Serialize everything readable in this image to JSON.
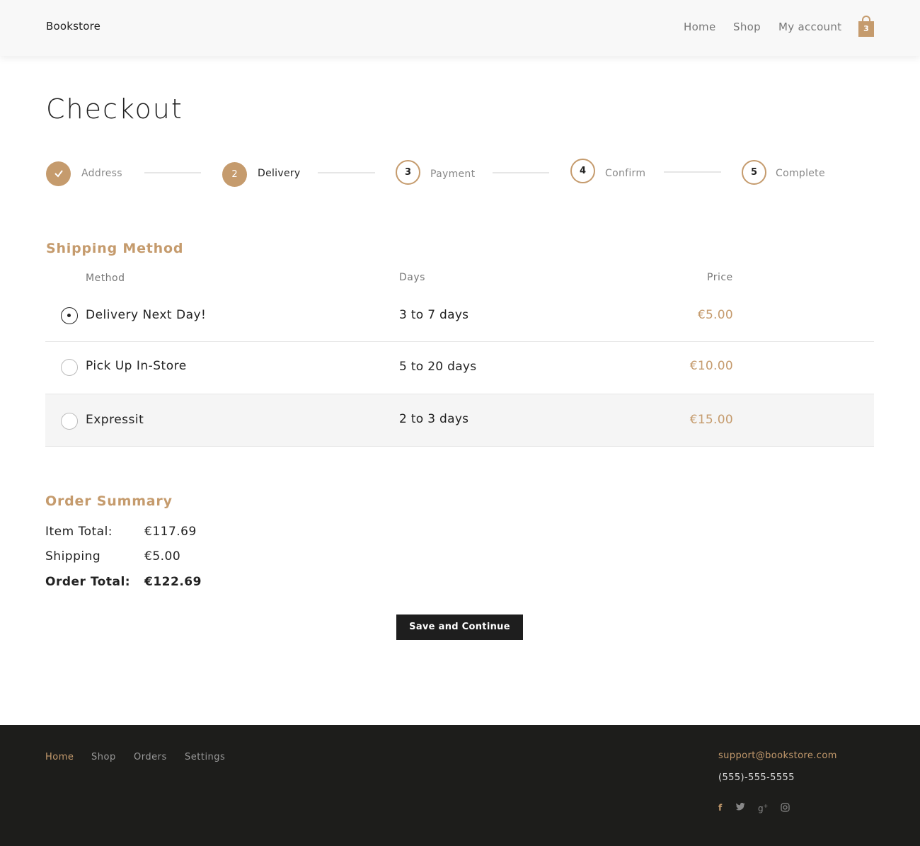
{
  "header": {
    "brand": "Bookstore",
    "nav": [
      "Home",
      "Shop",
      "My account"
    ],
    "cart_count": "3"
  },
  "page_title": "Checkout",
  "steps": [
    {
      "number": "✓",
      "label": "Address",
      "state": "done"
    },
    {
      "number": "2",
      "label": "Delivery",
      "state": "active"
    },
    {
      "number": "3",
      "label": "Payment",
      "state": "todo"
    },
    {
      "number": "4",
      "label": "Confirm",
      "state": "todo"
    },
    {
      "number": "5",
      "label": "Complete",
      "state": "todo"
    }
  ],
  "shipping": {
    "title": "Shipping Method",
    "headers": {
      "method": "Method",
      "days": "Days",
      "price": "Price"
    },
    "methods": [
      {
        "name": "Delivery Next Day!",
        "days": "3 to 7 days",
        "price": "€5.00",
        "selected": true
      },
      {
        "name": "Pick Up In-Store",
        "days": "5 to 20 days",
        "price": "€10.00",
        "selected": false
      },
      {
        "name": "Expressit",
        "days": "2 to 3 days",
        "price": "€15.00",
        "selected": false
      }
    ]
  },
  "summary": {
    "title": "Order Summary",
    "item_total_label": "Item Total:",
    "item_total_value": "€117.69",
    "shipping_label": "Shipping",
    "shipping_value": "€5.00",
    "order_total_label": "Order Total:",
    "order_total_value": "€122.69"
  },
  "button": {
    "save_label": "Save and Continue"
  },
  "footer": {
    "nav": [
      "Home",
      "Shop",
      "Orders",
      "Settings"
    ],
    "email": "support@bookstore.com",
    "phone": "(555)-555-5555",
    "social_icons": [
      "facebook-icon",
      "twitter-icon",
      "google-plus-icon",
      "instagram-icon"
    ]
  },
  "colors": {
    "accent": "#c59b6d",
    "dark": "#1e1e1e",
    "footer_bg": "#1d1d1b"
  }
}
